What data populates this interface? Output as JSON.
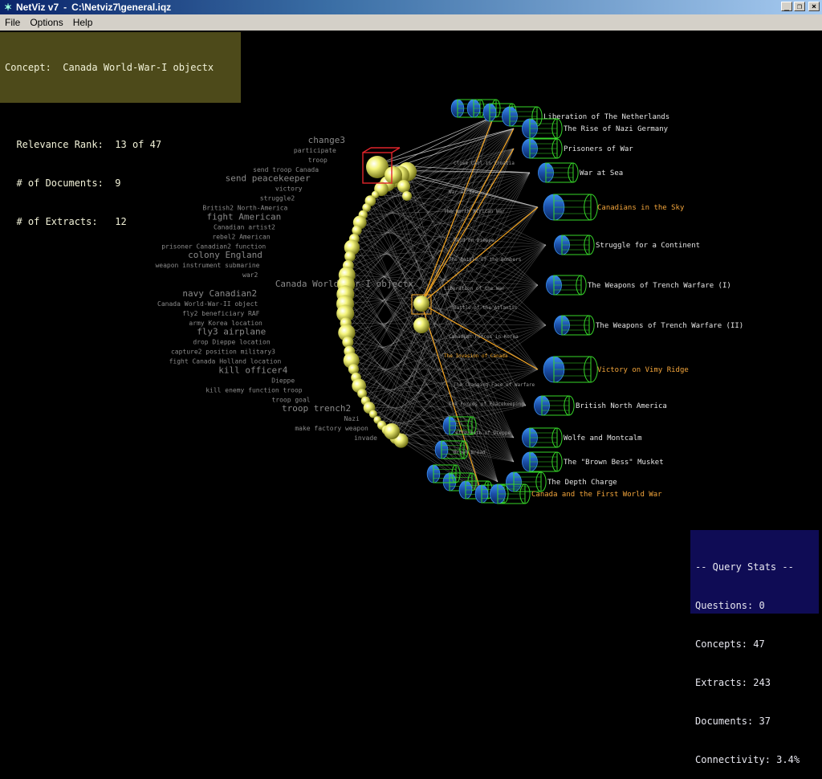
{
  "window": {
    "title": "NetViz v7",
    "path": "C:\\Netviz7\\general.iqz"
  },
  "menu": [
    "File",
    "Options",
    "Help"
  ],
  "concept_panel": {
    "concept_label": "Concept:  Canada World-War-I objectx",
    "rank_label": "  Relevance Rank:  13 of 47",
    "docs_label": "  # of Documents:  9",
    "extracts_label": "  # of Extracts:   12"
  },
  "stats": {
    "header": "-- Query Stats --",
    "questions": "Questions: 0",
    "concepts": "Concepts: 47",
    "extracts": "Extracts: 243",
    "documents": "Documents: 37",
    "connectivity": "Connectivity: 3.4%"
  },
  "concepts": [
    "change3",
    "participate",
    "troop",
    "send troop Canada",
    "send peacekeeper",
    "victory",
    "struggle2",
    "British2 North-America",
    "fight American",
    "Canadian artist2",
    "rebel2 American",
    "prisoner Canadian2 function",
    "colony England",
    "weapon instrument submarine",
    "war2",
    "Canada World-War-I objectx",
    "navy Canadian2",
    "Canada World-War-II object",
    "fly2 beneficiary RAF",
    "army Korea location",
    "fly3 airplane",
    "drop Dieppe location",
    "capture2 position military3",
    "fight Canada Holland location",
    "kill officer4",
    "Dieppe",
    "kill enemy function troop",
    "troop goal",
    "troop trench2",
    "Nazi",
    "make factory weapon",
    "invade"
  ],
  "documents": [
    "Liberation of The Netherlands",
    "The Rise of Nazi Germany",
    "Prisoners of War",
    "War at Sea",
    "Canadians in the Sky",
    "Struggle for a Continent",
    "The Weapons of Trench Warfare (I)",
    "The Weapons of Trench Warfare (II)",
    "Victory on Vimy Ridge",
    "British North America",
    "Wolfe and Montcalm",
    "The \"Brown Bess\" Musket",
    "The Depth Charge",
    "Canada and the First World War"
  ],
  "highlight_docs": [
    "Canadians in the Sky",
    "Victory on Vimy Ridge",
    "Canada and the First World War"
  ],
  "small_labels": [
    "Close Call in Croatia",
    "War at Sea",
    "The North African War",
    "Raid on Dieppe",
    "The Battle of the Bombers",
    "Liberation of the War",
    "Battle of the Atlantic",
    "Canadian Forces in Korea",
    "The Invasion of Canada",
    "The Changing Face of Warfare",
    "The Forces of Peacekeeping",
    "The Aftermath of Dieppe",
    "Brown Bread"
  ],
  "colors": {
    "concept_sphere": "#f4f47a",
    "doc_cylinder": "#2a6fd6",
    "doc_frame": "#36d629",
    "link_hi": "#f5a623",
    "link": "#cfcfcf",
    "select_box": "#e0242a"
  }
}
